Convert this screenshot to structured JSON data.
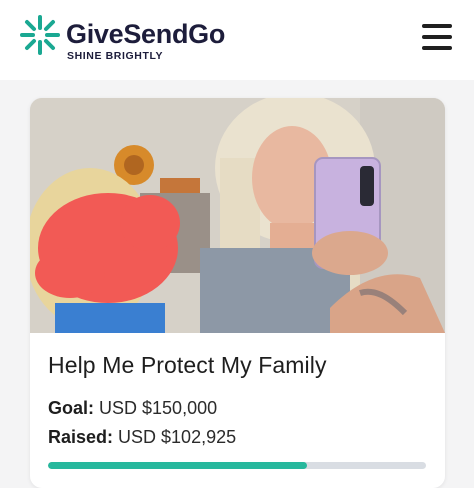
{
  "brand": {
    "name": "GiveSendGo",
    "tagline": "SHINE BRIGHTLY",
    "logo_color": "#1aa892"
  },
  "header": {
    "menu_icon": "hamburger-menu-icon"
  },
  "campaign": {
    "title": "Help Me Protect My Family",
    "goal_label": "Goal:",
    "goal_value": "USD $150,000",
    "raised_label": "Raised:",
    "raised_value": "USD $102,925",
    "progress_fraction": 0.686,
    "progress_color": "#27b89d"
  }
}
